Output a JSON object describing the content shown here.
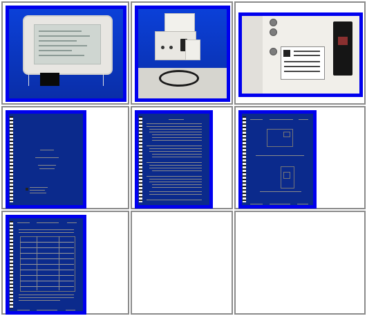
{
  "thumbnails": [
    {
      "name": "thumb-display-unit-photo"
    },
    {
      "name": "thumb-bench-equipment-photo"
    },
    {
      "name": "thumb-rear-panel-photo"
    },
    {
      "name": "thumb-manual-cover-page"
    },
    {
      "name": "thumb-table-of-contents-page"
    },
    {
      "name": "thumb-diagram-page"
    },
    {
      "name": "thumb-specifications-table-page"
    }
  ],
  "colors": {
    "thumb_border": "#0000ee",
    "cell_border": "#8a8a8a",
    "background": "#ffffff"
  }
}
